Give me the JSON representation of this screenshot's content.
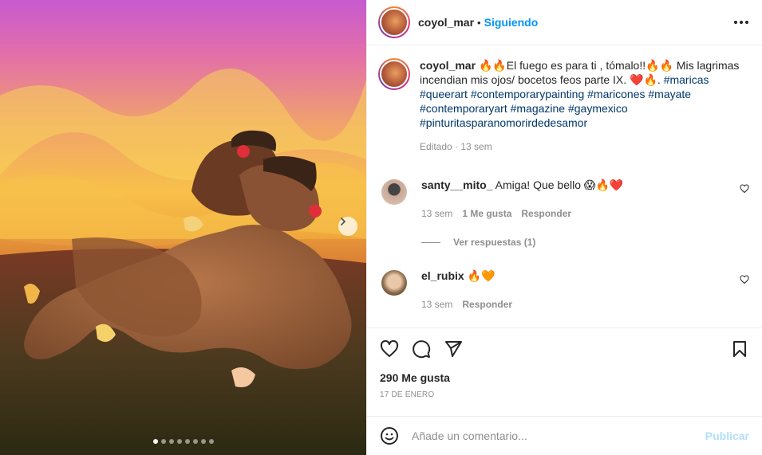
{
  "post": {
    "username": "coyol_mar",
    "separator": "•",
    "follow_status": "Siguiendo",
    "caption": {
      "username": "coyol_mar",
      "text": "🔥🔥El fuego es para ti , tómalo!!🔥🔥 Mis lagrimas incendian mis ojos/ bocetos feos parte IX. ❤️🔥. ",
      "hashtags": "#maricas #queerart #contemporarypainting #maricones #mayate #contemporaryart #magazine #gaymexico #pinturitasparanomorirdedesamor",
      "meta": "Editado · 13 sem"
    },
    "comments": [
      {
        "username": "santy__mito_",
        "text": "Amiga! Que bello 😱🔥❤️",
        "time": "13 sem",
        "likes": "1 Me gusta",
        "reply": "Responder",
        "view_replies": "Ver respuestas (1)"
      },
      {
        "username": "el_rubix",
        "text": "🔥🧡",
        "time": "13 sem",
        "reply": "Responder"
      }
    ],
    "likes": "290 Me gusta",
    "date": "17 DE ENERO",
    "add_comment_placeholder": "Añade un comentario...",
    "publish_label": "Publicar",
    "carousel": {
      "slide_count": 8,
      "active_index": 0
    }
  },
  "colors": {
    "accent": "#0095f6",
    "hashtag": "#00376b",
    "muted": "#8e8e8e",
    "publish_disabled": "#b2dffc",
    "heart_red": "#ed4956"
  },
  "icons": [
    "more-options-icon",
    "heart-icon",
    "comment-icon",
    "share-icon",
    "save-icon",
    "emoji-icon",
    "next-slide-icon"
  ]
}
